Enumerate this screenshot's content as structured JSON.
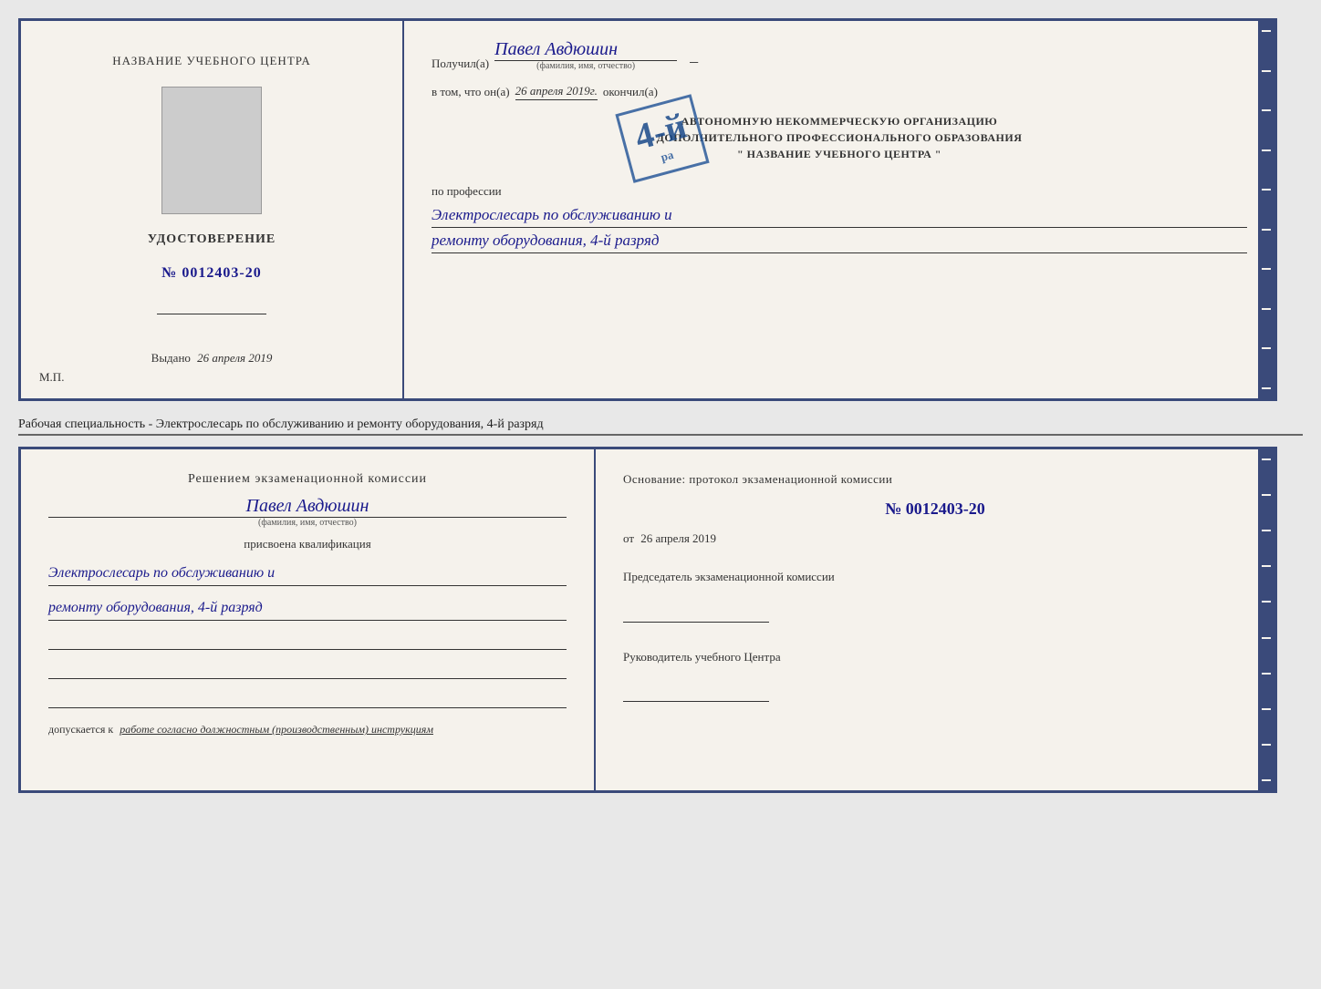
{
  "top_doc": {
    "left": {
      "center_title": "НАЗВАНИЕ УЧЕБНОГО ЦЕНТРА",
      "cert_label": "УДОСТОВЕРЕНИЕ",
      "cert_number": "№ 0012403-20",
      "issued_label": "Выдано",
      "issued_date": "26 апреля 2019",
      "mp_label": "М.П."
    },
    "right": {
      "recipient_prefix": "Получил(a)",
      "recipient_name": "Павел Авдюшин",
      "recipient_subtitle": "(фамилия, имя, отчество)",
      "vtom_prefix": "в том, что он(а)",
      "vtom_date": "26 апреля 2019г.",
      "vtom_okonchil": "окончил(а)",
      "org_line1": "АВТОНОМНУЮ НЕКОММЕРЧЕСКУЮ ОРГАНИЗАЦИЮ",
      "org_line2": "ДОПОЛНИТЕЛЬНОГО ПРОФЕССИОНАЛЬНОГО ОБРАЗОВАНИЯ",
      "org_line3": "\" НАЗВАНИЕ УЧЕБНОГО ЦЕНТРА \"",
      "profession_label": "по профессии",
      "profession_line1": "Электрослесарь по обслуживанию и",
      "profession_line2": "ремонту оборудования, 4-й разряд"
    },
    "stamp": {
      "num_big": "4-й",
      "text": "ра"
    }
  },
  "separator": {
    "text": "Рабочая специальность - Электрослесарь по обслуживанию и ремонту оборудования, 4-й разряд"
  },
  "bottom_doc": {
    "left": {
      "decision_title": "Решением экзаменационной комиссии",
      "person_name": "Павел Авдюшин",
      "person_subtitle": "(фамилия, имя, отчество)",
      "assigned_label": "присвоена квалификация",
      "qual_line1": "Электрослесарь по обслуживанию и",
      "qual_line2": "ремонту оборудования, 4-й разряд",
      "allowed_prefix": "допускается к",
      "allowed_value": "работе согласно должностным (производственным) инструкциям"
    },
    "right": {
      "basis_prefix": "Основание: протокол экзаменационной комиссии",
      "basis_number": "№ 0012403-20",
      "basis_date_prefix": "от",
      "basis_date": "26 апреля 2019",
      "chairman_label": "Председатель экзаменационной комиссии",
      "director_label": "Руководитель учебного Центра"
    }
  }
}
